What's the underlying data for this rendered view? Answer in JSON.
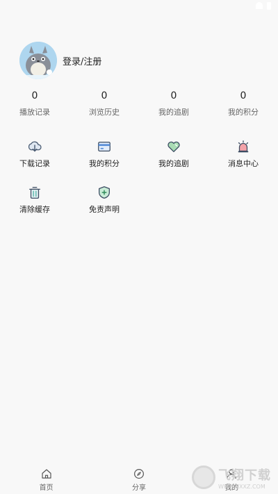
{
  "profile": {
    "login_label": "登录/注册"
  },
  "stats": [
    {
      "value": "0",
      "label": "播放记录"
    },
    {
      "value": "0",
      "label": "浏览历史"
    },
    {
      "value": "0",
      "label": "我的追剧"
    },
    {
      "value": "0",
      "label": "我的积分"
    }
  ],
  "grid": [
    {
      "label": "下载记录",
      "icon": "cloud-download-icon"
    },
    {
      "label": "我的积分",
      "icon": "card-icon"
    },
    {
      "label": "我的追剧",
      "icon": "heart-icon"
    },
    {
      "label": "消息中心",
      "icon": "alarm-bell-icon"
    },
    {
      "label": "清除缓存",
      "icon": "trash-icon"
    },
    {
      "label": "免责声明",
      "icon": "shield-icon"
    }
  ],
  "nav": [
    {
      "label": "首页",
      "icon": "home-icon"
    },
    {
      "label": "分享",
      "icon": "compass-icon"
    },
    {
      "label": "我的",
      "icon": "user-icon"
    }
  ],
  "watermark": {
    "main": "飞翔下载",
    "sub": "WWW.FXXZ.COM"
  },
  "colors": {
    "background": "#f8f8f8",
    "avatar_bg": "#aed6ef",
    "heart": "#7fbf8c",
    "alarm": "#e57c83",
    "card": "#5a8fd8",
    "shield": "#4caf78"
  }
}
